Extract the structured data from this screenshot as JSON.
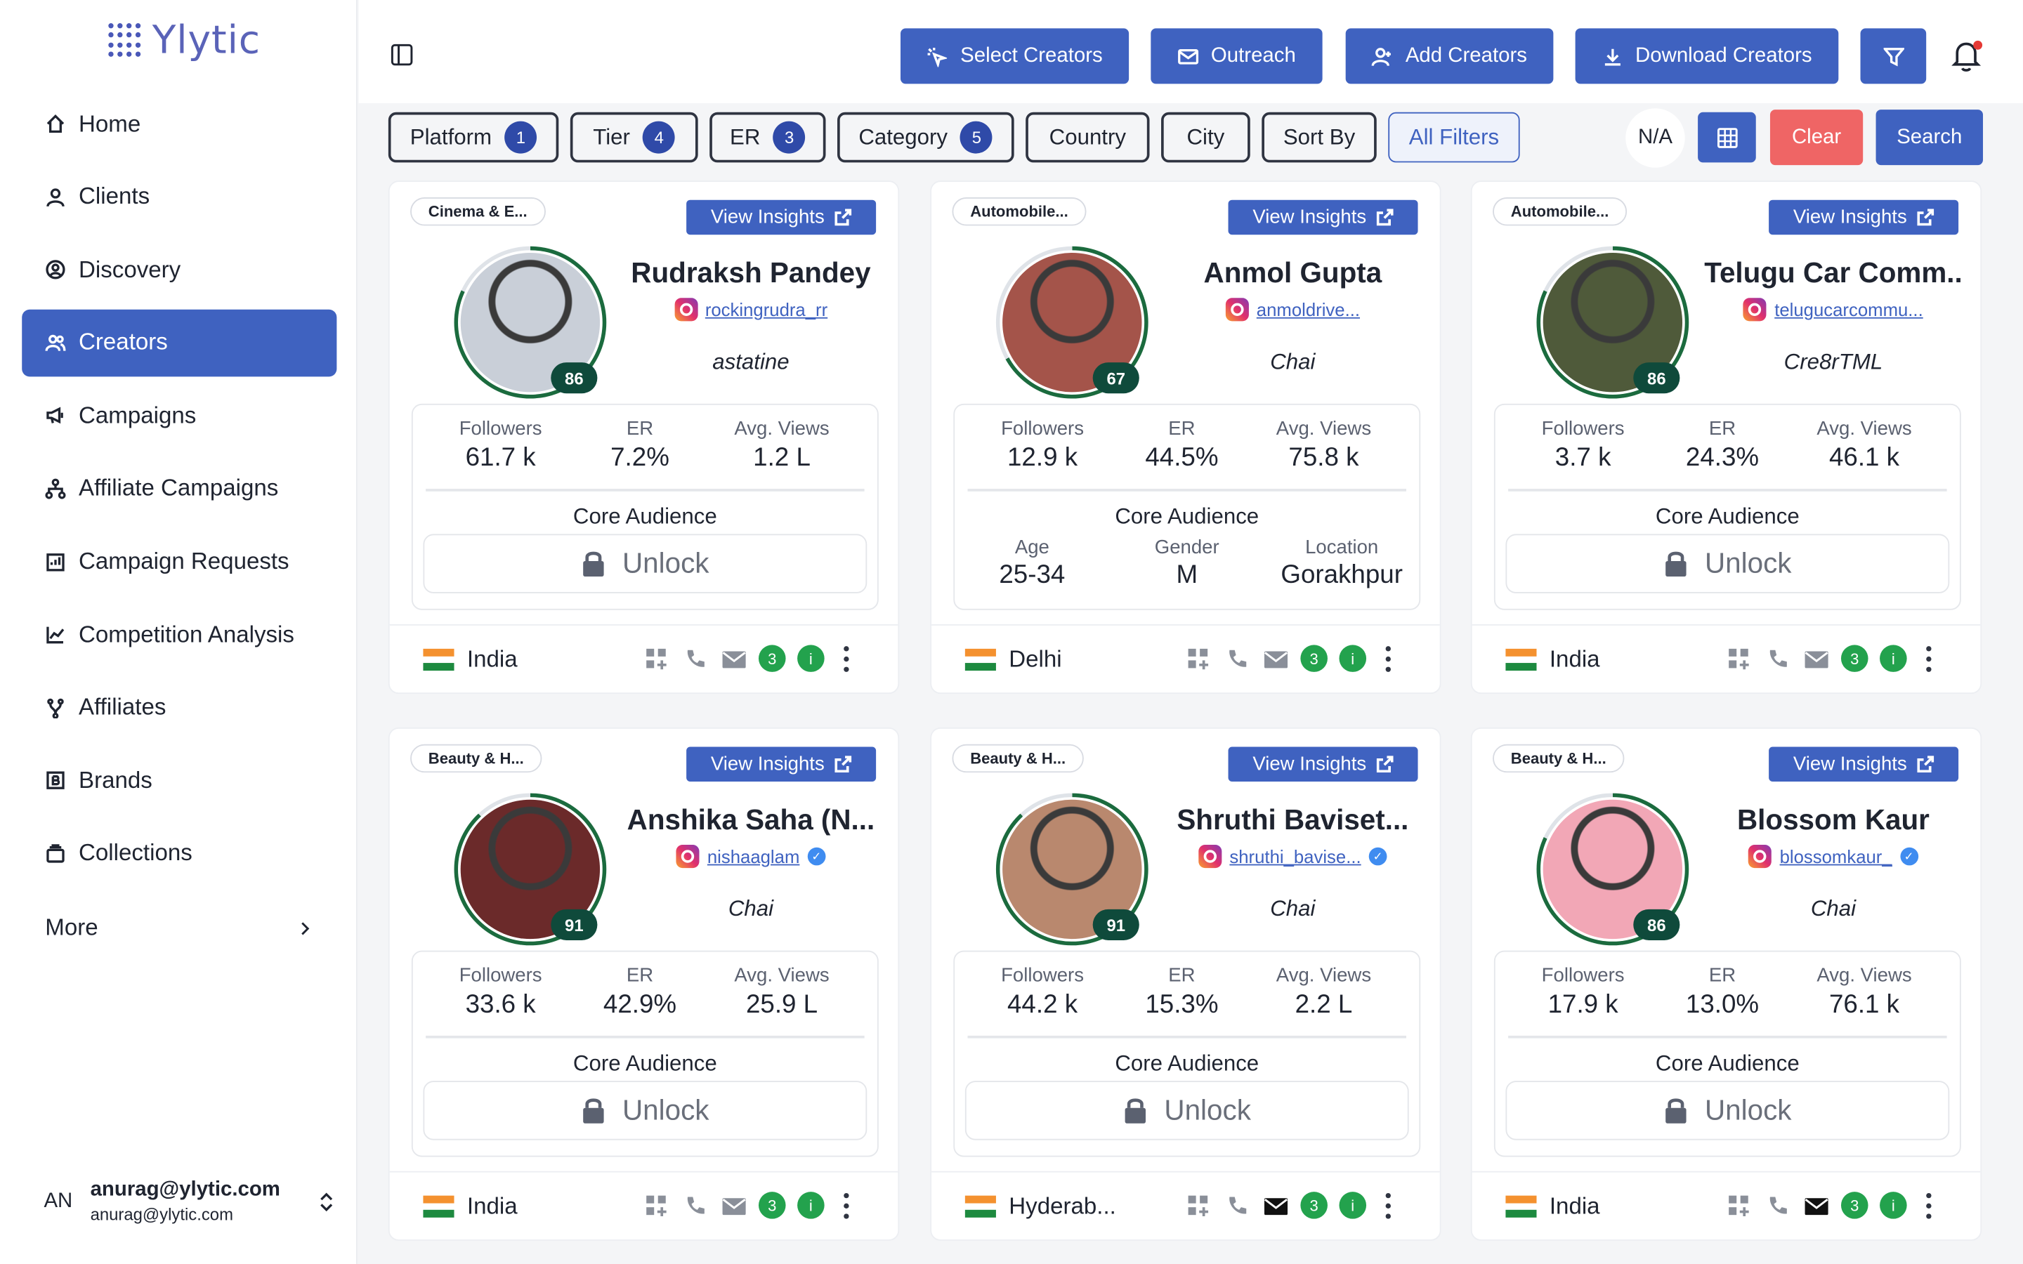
{
  "app": {
    "logo_text": "Ylytic"
  },
  "sidebar": {
    "items": [
      {
        "label": "Home",
        "icon": "home-icon"
      },
      {
        "label": "Clients",
        "icon": "user-icon"
      },
      {
        "label": "Discovery",
        "icon": "discovery-icon"
      },
      {
        "label": "Creators",
        "icon": "creators-icon",
        "active": true
      },
      {
        "label": "Campaigns",
        "icon": "megaphone-icon"
      },
      {
        "label": "Affiliate Campaigns",
        "icon": "network-icon"
      },
      {
        "label": "Campaign Requests",
        "icon": "request-icon"
      },
      {
        "label": "Competition Analysis",
        "icon": "chart-icon"
      },
      {
        "label": "Affiliates",
        "icon": "fork-icon"
      },
      {
        "label": "Brands",
        "icon": "brand-icon"
      },
      {
        "label": "Collections",
        "icon": "collections-icon"
      }
    ],
    "more_label": "More",
    "user": {
      "initials": "AN",
      "name": "anurag@ylytic.com",
      "email": "anurag@ylytic.com"
    }
  },
  "topbar": {
    "select_creators": "Select Creators",
    "outreach": "Outreach",
    "add_creators": "Add Creators",
    "download_creators": "Download Creators"
  },
  "filters": {
    "platform": {
      "label": "Platform",
      "count": "1"
    },
    "tier": {
      "label": "Tier",
      "count": "4"
    },
    "er": {
      "label": "ER",
      "count": "3"
    },
    "category": {
      "label": "Category",
      "count": "5"
    },
    "country": "Country",
    "city": "City",
    "sort_by": "Sort By",
    "all_filters": "All Filters",
    "na": "N/A",
    "clear": "Clear",
    "search": "Search"
  },
  "labels": {
    "view_insights": "View Insights",
    "followers": "Followers",
    "er": "ER",
    "avg_views": "Avg. Views",
    "core_audience": "Core Audience",
    "unlock": "Unlock",
    "age": "Age",
    "gender": "Gender",
    "location": "Location"
  },
  "creators": [
    {
      "category": "Cinema & E...",
      "name": "Rudraksh Pandey",
      "handle": "rockingrudra_rr",
      "verified": false,
      "subtitle": "astatine",
      "score": "86",
      "followers": "61.7 k",
      "er": "7.2%",
      "avg_views": "1.2 L",
      "audience": null,
      "location": "India",
      "ring": 0.82,
      "avatar_color": "#c9cfd8"
    },
    {
      "category": "Automobile...",
      "name": "Anmol Gupta",
      "handle": "anmoldrive...",
      "verified": false,
      "subtitle": "Chai",
      "score": "67",
      "followers": "12.9 k",
      "er": "44.5%",
      "avg_views": "75.8 k",
      "audience": {
        "age": "25-34",
        "gender": "M",
        "location": "Gorakhpur"
      },
      "location": "Delhi",
      "ring": 0.67,
      "avatar_color": "#a4544a"
    },
    {
      "category": "Automobile...",
      "name": "Telugu Car Comm...",
      "handle": "telugucarcommu...",
      "verified": false,
      "subtitle": "Cre8rTML",
      "score": "86",
      "followers": "3.7 k",
      "er": "24.3%",
      "avg_views": "46.1 k",
      "audience": null,
      "location": "India",
      "ring": 0.82,
      "avatar_color": "#4f5a3a"
    },
    {
      "category": "Beauty & H...",
      "name": "Anshika Saha (N...",
      "handle": "nishaaglam",
      "verified": true,
      "subtitle": "Chai",
      "score": "91",
      "followers": "33.6 k",
      "er": "42.9%",
      "avg_views": "25.9 L",
      "audience": null,
      "location": "India",
      "ring": 0.88,
      "avatar_color": "#6b2a2a"
    },
    {
      "category": "Beauty & H...",
      "name": "Shruthi Baviset...",
      "handle": "shruthi_bavise...",
      "verified": true,
      "subtitle": "Chai",
      "score": "91",
      "followers": "44.2 k",
      "er": "15.3%",
      "avg_views": "2.2 L",
      "audience": null,
      "location": "Hyderab...",
      "ring": 0.88,
      "avatar_color": "#b9886e"
    },
    {
      "category": "Beauty & H...",
      "name": "Blossom Kaur",
      "handle": "blossomkaur_",
      "verified": true,
      "subtitle": "Chai",
      "score": "86",
      "followers": "17.9 k",
      "er": "13.0%",
      "avg_views": "76.1 k",
      "audience": null,
      "location": "India",
      "ring": 0.82,
      "avatar_color": "#f2a7b6"
    }
  ],
  "colors": {
    "accent": "#3f62c0",
    "clear": "#ef6565",
    "score_bg": "#0f4a3b",
    "ring": "#1b6b3e",
    "green": "#23a24d"
  }
}
